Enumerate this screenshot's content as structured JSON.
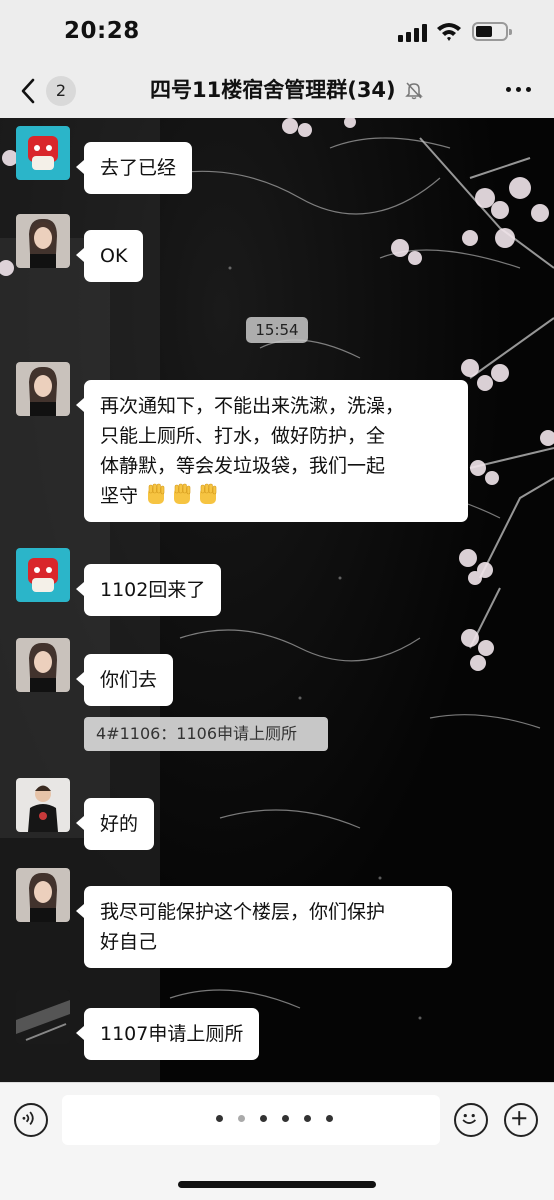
{
  "status_bar": {
    "time": "20:28"
  },
  "header": {
    "back_count": "2",
    "title": "四号11楼宿舍管理群(34)",
    "mute_icon": "bell-slash-icon",
    "more_icon": "more-dots-icon"
  },
  "timestamp": "15:54",
  "messages": [
    {
      "avatar": "red-cartoon-avatar",
      "text": "去了已经"
    },
    {
      "avatar": "girl-photo-avatar",
      "text": "OK"
    },
    {
      "avatar": "girl-photo-avatar",
      "lines": [
        "再次通知下，不能出来洗漱，洗澡，",
        "只能上厕所、打水，做好防护，全",
        "体静默，等会发垃圾袋，我们一起",
        "坚守"
      ],
      "emoji": "raised-fist-emoji"
    },
    {
      "avatar": "red-cartoon-avatar",
      "text": "1102回来了"
    },
    {
      "avatar": "girl-photo-avatar",
      "text": "你们去"
    },
    {
      "avatar": "black-shirt-avatar",
      "text": "好的"
    },
    {
      "avatar": "girl-photo-avatar",
      "lines": [
        "我尽可能保护这个楼层，你们保护",
        "好自己"
      ]
    },
    {
      "avatar": "dark-photo-avatar",
      "text": "1107申请上厕所"
    }
  ],
  "quote": "4#1106：1106申请上厕所",
  "input_bar": {
    "voice_icon": "voice-icon",
    "emoji_icon": "smile-icon",
    "plus_icon": "plus-icon"
  },
  "colors": {
    "bubble": "#ffffff",
    "chat_background": "#070707",
    "bar": "#ededed"
  }
}
